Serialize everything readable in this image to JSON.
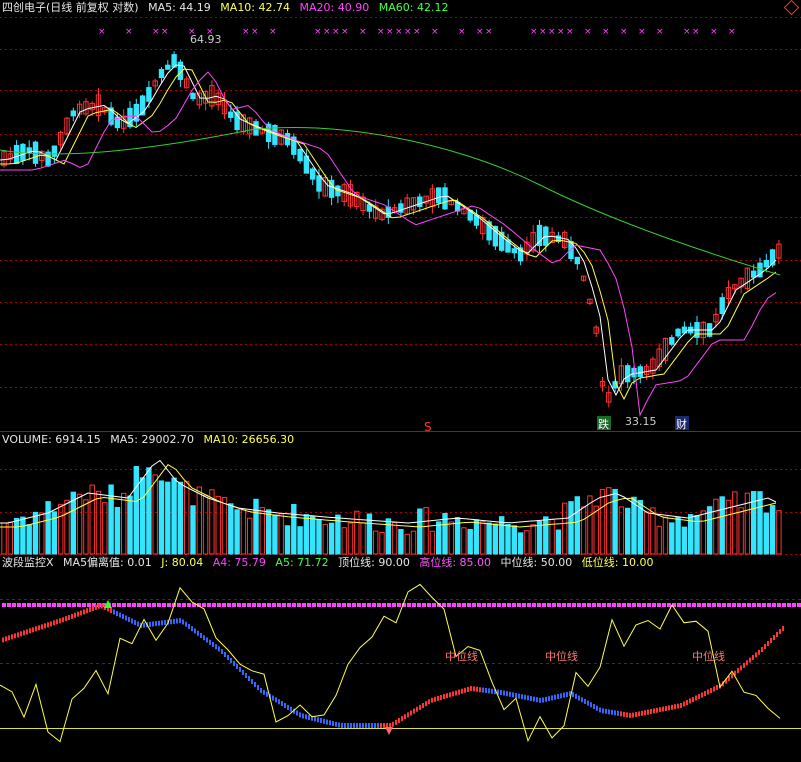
{
  "main_legend": {
    "title": "四创电子(日线 前复权 对数)",
    "ma5": "MA5: 44.19",
    "ma10": "MA10: 42.74",
    "ma20": "MA20: 40.90",
    "ma60": "MA60: 42.12"
  },
  "price_annotations": {
    "high": "64.93",
    "low": "33.15",
    "mark_s": "S",
    "tag_die": "跌",
    "tag_cai": "财"
  },
  "volume_legend": {
    "volume": "VOLUME: 6914.15",
    "ma5": "MA5: 29002.70",
    "ma10": "MA10: 26656.30"
  },
  "indicator_legend": {
    "name": "波段监控X",
    "dev": "MA5偏离值: 0.01",
    "j": "J: 80.04",
    "a4": "A4: 75.79",
    "a5": "A5: 71.72",
    "top": "顶位线: 90.00",
    "high": "高位线: 85.00",
    "mid": "中位线: 50.00",
    "low": "低位线: 10.00"
  },
  "indicator_labels": [
    "中位线",
    "中位线",
    "中位线"
  ],
  "colors": {
    "up": "#ff3333",
    "down": "#33e5ff",
    "ma5": "#ffffff",
    "ma10": "#ffff44",
    "ma20": "#ff44ff",
    "ma60": "#33cc33",
    "grid": "#aa0000"
  },
  "icon": "diamond-icon"
}
